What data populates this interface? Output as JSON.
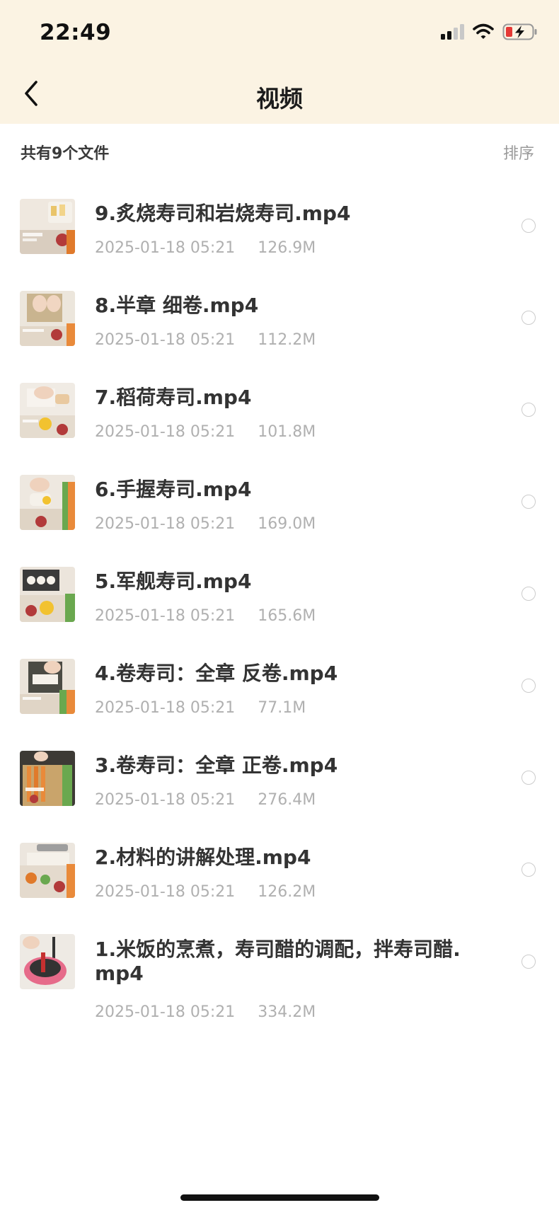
{
  "status_bar": {
    "time": "22:49",
    "icons": [
      "signal-icon",
      "wifi-icon",
      "battery-charging-icon"
    ]
  },
  "nav": {
    "title": "视频",
    "back_icon": "chevron-left-icon"
  },
  "list_header": {
    "count_text": "共有9个文件",
    "sort_label": "排序"
  },
  "colors": {
    "header_bg": "#fbf3e3",
    "title_text": "#333333",
    "meta_text": "#b0b0b0",
    "battery_low": "#e53935"
  },
  "files": [
    {
      "name": "9.炙烧寿司和岩烧寿司.mp4",
      "date": "2025-01-18 05:21",
      "size": "126.9M",
      "thumb_icon": "video-thumbnail"
    },
    {
      "name": "8.半章 细卷.mp4",
      "date": "2025-01-18 05:21",
      "size": "112.2M",
      "thumb_icon": "video-thumbnail"
    },
    {
      "name": "7.稻荷寿司.mp4",
      "date": "2025-01-18 05:21",
      "size": "101.8M",
      "thumb_icon": "video-thumbnail"
    },
    {
      "name": "6.手握寿司.mp4",
      "date": "2025-01-18 05:21",
      "size": "169.0M",
      "thumb_icon": "video-thumbnail"
    },
    {
      "name": "5.军舰寿司.mp4",
      "date": "2025-01-18 05:21",
      "size": "165.6M",
      "thumb_icon": "video-thumbnail"
    },
    {
      "name": "4.卷寿司：全章 反卷.mp4",
      "date": "2025-01-18 05:21",
      "size": "77.1M",
      "thumb_icon": "video-thumbnail"
    },
    {
      "name": "3.卷寿司：全章 正卷.mp4",
      "date": "2025-01-18 05:21",
      "size": "276.4M",
      "thumb_icon": "video-thumbnail"
    },
    {
      "name": "2.材料的讲解处理.mp4",
      "date": "2025-01-18 05:21",
      "size": "126.2M",
      "thumb_icon": "video-thumbnail"
    },
    {
      "name": "1.米饭的烹煮，寿司醋的调配，拌寿司醋.mp4",
      "date": "2025-01-18 05:21",
      "size": "334.2M",
      "thumb_icon": "video-thumbnail"
    }
  ]
}
